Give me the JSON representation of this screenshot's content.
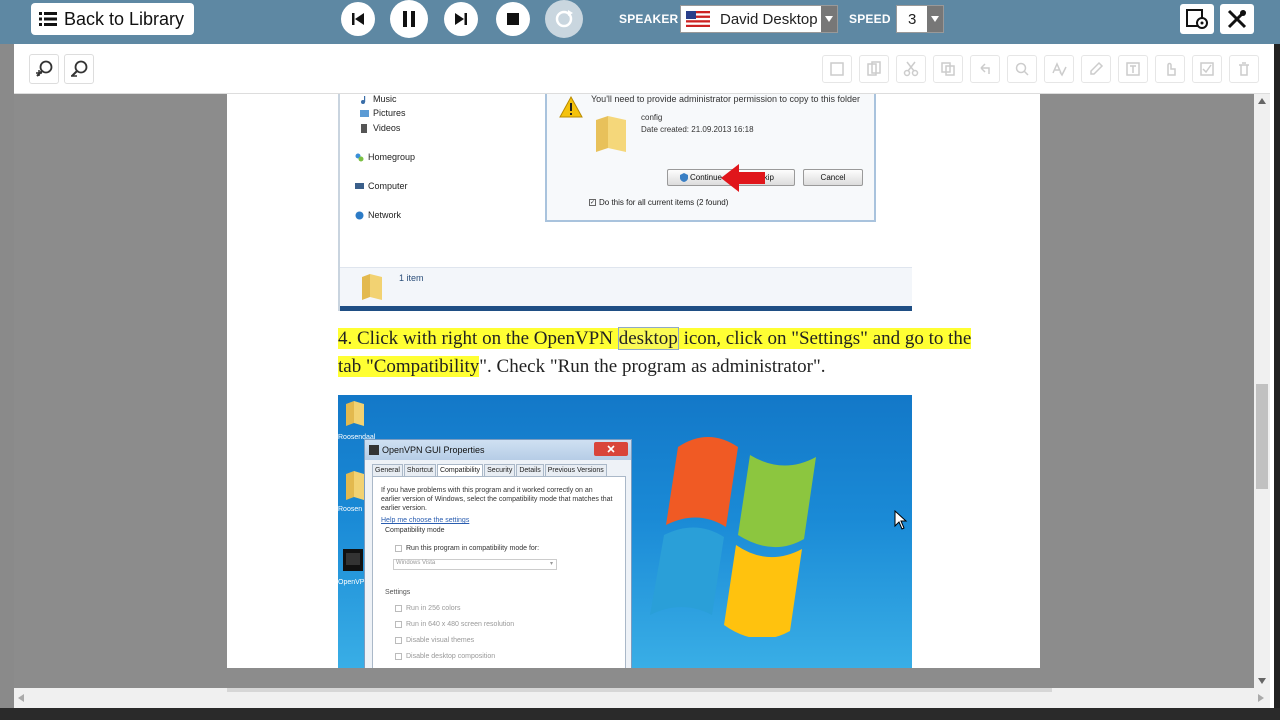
{
  "toolbar": {
    "back_label": "Back to Library",
    "speaker_label": "SPEAKER",
    "speaker_value": "David Desktop",
    "speed_label": "SPEED",
    "speed_value": "3"
  },
  "explorer": {
    "nav": [
      "Music",
      "Pictures",
      "Videos",
      "Homegroup",
      "Computer",
      "Network"
    ],
    "dialog_message": "You'll need to provide administrator permission to copy to this folder",
    "folder_name": "config",
    "folder_date": "Date created: 21.09.2013 16:18",
    "continue_label": "Continue",
    "skip_label": "kip",
    "cancel_label": "Cancel",
    "checkbox_label": "Do this for all current items (2 found)",
    "item_count": "1 item"
  },
  "instruction": {
    "part1": "4. Click with right on the OpenVPN ",
    "word": "desktop",
    "part2": " icon, click on \"Settings\" and go to the tab \"Compatibility",
    "part3": "\". Check \"Run the program as administrator\"."
  },
  "props_window": {
    "title": "OpenVPN GUI Properties",
    "tabs": [
      "General",
      "Shortcut",
      "Compatibility",
      "Security",
      "Details",
      "Previous Versions"
    ],
    "intro": "If you have problems with this program and it worked correctly on an earlier version of Windows, select the compatibility mode that matches that earlier version.",
    "help_link": "Help me choose the settings",
    "compat_heading": "Compatibility mode",
    "compat_check": "Run this program in compatibility mode for:",
    "compat_combo": "Windows Vista",
    "settings_heading": "Settings",
    "settings": [
      "Run in 256 colors",
      "Run in 640 x 480 screen resolution",
      "Disable visual themes",
      "Disable desktop composition"
    ]
  },
  "desktop_icons": [
    "Roosendaal",
    "Roosen",
    "OpenVPN"
  ]
}
